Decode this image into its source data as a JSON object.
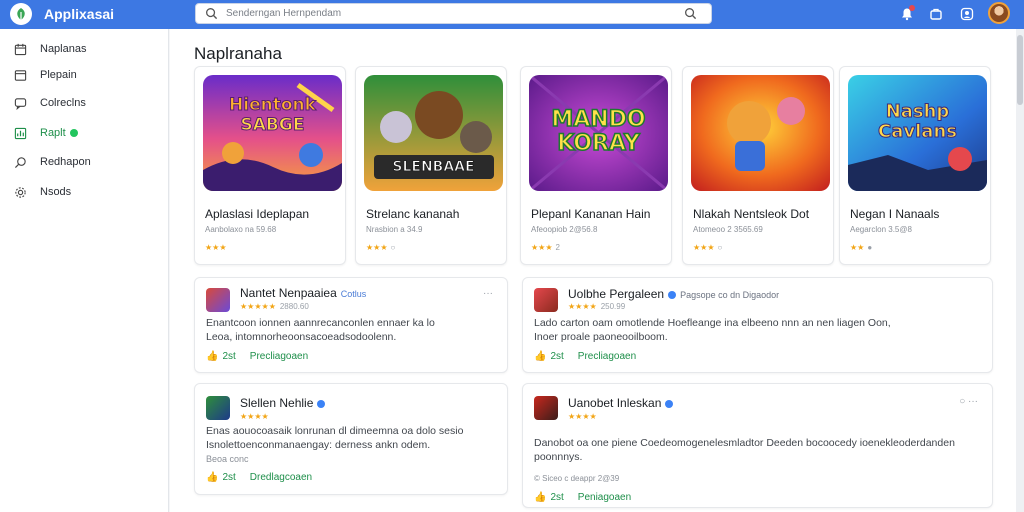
{
  "header": {
    "app_title": "Applixasai",
    "search_placeholder": "Senderngan Hernpendam"
  },
  "sidebar": {
    "items": [
      {
        "label": "Naplanas",
        "icon": "calendar-icon"
      },
      {
        "label": "Plepain",
        "icon": "window-icon"
      },
      {
        "label": "Colreclns",
        "icon": "chat-icon"
      },
      {
        "label": "Raplt",
        "icon": "chart-icon",
        "active": true
      },
      {
        "label": "Redhapon",
        "icon": "search-icon"
      },
      {
        "label": "Nsods",
        "icon": "gear-icon"
      }
    ]
  },
  "main": {
    "section_title": "Naplranaha",
    "apps": [
      {
        "name": "Aplaslasi Ideplapan",
        "meta": "Aanbolaxo na 59.68",
        "stars": "★★★",
        "extra": "",
        "thumb_text": [
          "Hientonk",
          "SABGE"
        ]
      },
      {
        "name": "Strelanc kananah",
        "meta": "Nrasbion a 34.9",
        "stars": "★★★",
        "extra": "○",
        "thumb_text": [
          "SLENBAAE"
        ]
      },
      {
        "name": "Plepanl Kananan Hain",
        "meta": "Afeoopiob 2@56.8",
        "stars": "★★★",
        "extra": "2",
        "thumb_text": [
          "MANDO",
          "KORAY"
        ]
      },
      {
        "name": "Nlakah Nentsleok Dot",
        "meta": "Atomeoo 2 3565.69",
        "stars": "★★★",
        "extra": "○",
        "thumb_text": []
      },
      {
        "name": "Negan I Nanaals",
        "meta": "Aegarclon 3.5@8",
        "stars": "★★",
        "extra": "●",
        "thumb_text": [
          "Nashp",
          "Cavlans"
        ]
      }
    ],
    "reviews": [
      {
        "title": "Nantet Nenpaaiea",
        "title_sub": "Cotlus",
        "stars": "★★★★★",
        "stars_extra": "2880.60",
        "body_lines": [
          "Enantcoon ionnen aannrecanconlen ennaer ka lo",
          "Leoa, intomnorheoonsacoeadsodoolenn."
        ],
        "likes": "2st",
        "action": "Precliagoaen",
        "more": "···"
      },
      {
        "title": "Uolbhe Pergaleen",
        "title_sub": "Pagsope co dn Digaodor",
        "stars": "★★★★",
        "stars_extra": "250.99",
        "body_lines": [
          "Lado carton oam omotlende Hoefleange ina elbeeno nnn an nen liagen Oon,",
          "Inoer proale paoneooilboom."
        ],
        "likes": "2st",
        "action": "Precliagoaen",
        "more": ""
      },
      {
        "title": "Slellen Nehlie",
        "title_sub": "",
        "stars": "★★★★",
        "stars_extra": "",
        "body_lines": [
          "Enas aouocoasaik lonrunan dl dimeemna oa dolo sesio",
          "Isnolettoenconmanaengay: derness ankn odem.",
          "Beoa conc"
        ],
        "likes": "2st",
        "action": "Dredlagcoaen",
        "more": ""
      },
      {
        "title": "Uanobet Inleskan",
        "title_sub": "",
        "stars": "★★★★",
        "stars_extra": "",
        "body_lines": [
          "Danobot oa one piene Coedeomogenelesmladtor Deeden bocoocedy ioenekleoderdanden",
          "poonnnys."
        ],
        "meta": "© Siceo c deappr 2@39",
        "likes": "2st",
        "action": "Peniagoaen",
        "more": "○    ···"
      }
    ]
  },
  "colors": {
    "topbar": "#3d78e3",
    "accent_green": "#1e8f4a",
    "star": "#f2a516"
  }
}
